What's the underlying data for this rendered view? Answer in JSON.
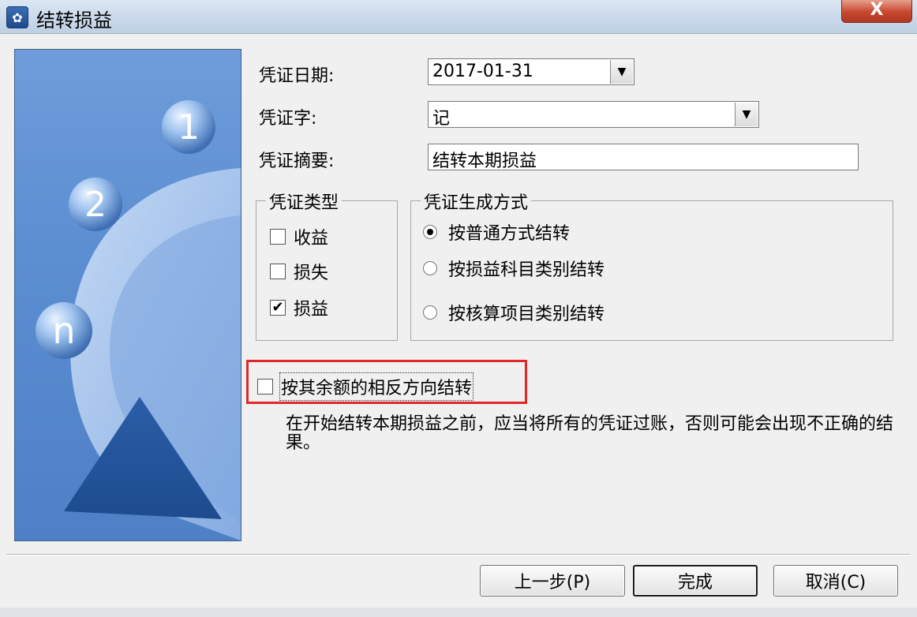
{
  "window": {
    "title": "结转损益",
    "close_label": "X"
  },
  "form": {
    "date_label": "凭证日期:",
    "date_value": "2017-01-31",
    "word_label": "凭证字:",
    "word_value": "记",
    "summary_label": "凭证摘要:",
    "summary_value": "结转本期损益"
  },
  "voucher_type": {
    "legend": "凭证类型",
    "options": [
      {
        "label": "收益",
        "checked": false
      },
      {
        "label": "损失",
        "checked": false
      },
      {
        "label": "损益",
        "checked": true
      }
    ]
  },
  "generate_method": {
    "legend": "凭证生成方式",
    "options": [
      {
        "label": "按普通方式结转",
        "selected": true
      },
      {
        "label": "按损益科目类别结转",
        "selected": false
      },
      {
        "label": "按核算项目类别结转",
        "selected": false
      }
    ]
  },
  "reverse_option": {
    "label": "按其余额的相反方向结转",
    "checked": false
  },
  "note": "在开始结转本期损益之前，应当将所有的凭证过账，否则可能会出现不正确的结果。",
  "illustration": {
    "step_labels": [
      "1",
      "2",
      "n"
    ]
  },
  "buttons": {
    "prev": "上一步(P)",
    "finish": "完成",
    "cancel": "取消(C)"
  },
  "colors": {
    "highlight": "#e0282a",
    "panel_blue": "#5c8ed2"
  }
}
